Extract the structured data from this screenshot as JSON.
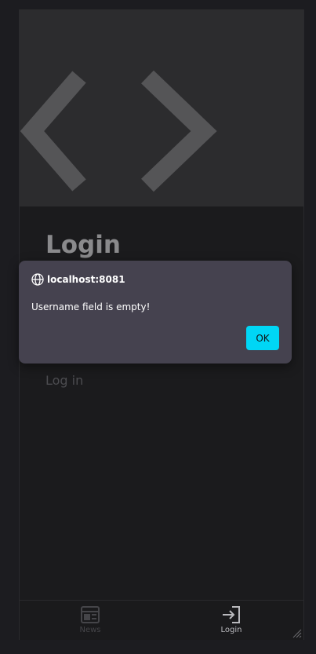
{
  "page": {
    "title": "Login",
    "login_link": "Log in"
  },
  "hero": {
    "icon": "code-brackets-icon"
  },
  "dialog": {
    "origin": "localhost:8081",
    "origin_icon": "globe-icon",
    "message": "Username field is empty!",
    "ok_label": "OK"
  },
  "bottom_nav": {
    "items": [
      {
        "label": "News",
        "icon": "news-icon",
        "active": false
      },
      {
        "label": "Login",
        "icon": "login-icon",
        "active": true
      }
    ]
  },
  "colors": {
    "accent": "#00d6f5",
    "dialog_bg": "#45424f",
    "background": "#1b1b1d"
  }
}
